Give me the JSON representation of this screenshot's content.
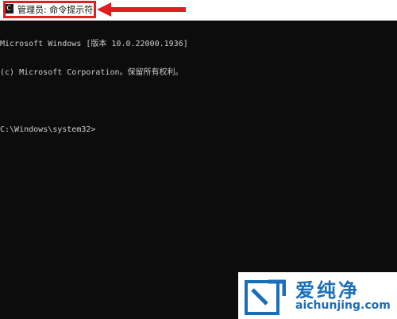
{
  "window": {
    "title": "管理员: 命令提示符",
    "icon": "cmd-icon"
  },
  "console": {
    "lines": [
      "Microsoft Windows [版本 10.0.22000.1936]",
      "(c) Microsoft Corporation。保留所有权利。",
      "",
      "C:\\Windows\\system32>"
    ]
  },
  "annotation": {
    "color": "#e02020"
  },
  "watermark": {
    "title": "爱纯净",
    "url": "aichunjing.com",
    "color": "#1b6fb8"
  }
}
